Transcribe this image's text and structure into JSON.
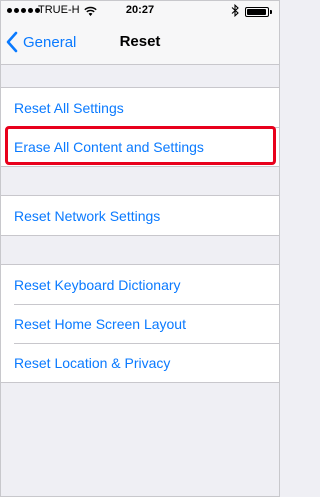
{
  "status_bar": {
    "carrier": "TRUE-H",
    "time": "20:27",
    "signal_icon": "signal-dots-icon",
    "wifi_icon": "wifi-icon",
    "bluetooth_icon": "bluetooth-icon",
    "battery_icon": "battery-icon",
    "battery_level": 0.95
  },
  "nav": {
    "back_label": "General",
    "back_icon": "chevron-left-icon",
    "title": "Reset",
    "accent_color": "#0a7aff"
  },
  "groups": [
    {
      "items": [
        "Reset All Settings",
        "Erase All Content and Settings"
      ]
    },
    {
      "items": [
        "Reset Network Settings"
      ]
    },
    {
      "items": [
        "Reset Keyboard Dictionary",
        "Reset Home Screen Layout",
        "Reset Location & Privacy"
      ]
    }
  ],
  "highlight": {
    "target": "Erase All Content and Settings",
    "color": "#e8001c"
  }
}
